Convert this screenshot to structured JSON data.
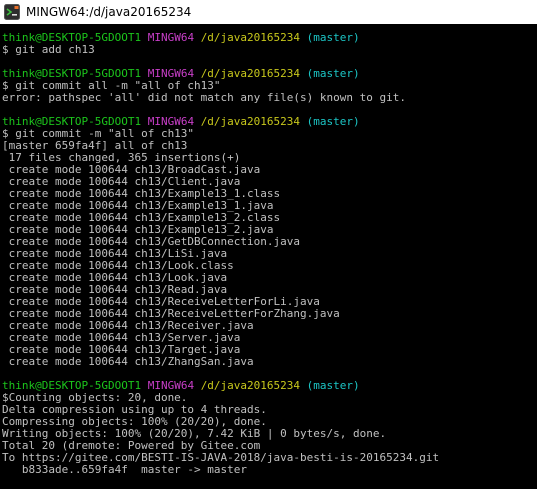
{
  "window": {
    "title": "MINGW64:/d/java20165234",
    "icon": "git-bash-icon"
  },
  "colors": {
    "background": "#000000",
    "text": "#c0c0c0",
    "prompt_user": "#1cc51c",
    "prompt_system": "#c93fc9",
    "prompt_path": "#c8c81c",
    "prompt_branch": "#1cc5c5"
  },
  "prompt": {
    "user": "think@DESKTOP-5GDOOT1",
    "system": "MINGW64",
    "path": "/d/java20165234",
    "branch": "(master)"
  },
  "blocks": [
    {
      "command": "$ git add ch13",
      "output": []
    },
    {
      "command": "$ git commit all -m \"all of ch13\"",
      "output": [
        "error: pathspec 'all' did not match any file(s) known to git."
      ]
    },
    {
      "command": "$ git commit -m \"all of ch13\"",
      "output": [
        "[master 659fa4f] all of ch13",
        " 17 files changed, 365 insertions(+)",
        " create mode 100644 ch13/BroadCast.java",
        " create mode 100644 ch13/Client.java",
        " create mode 100644 ch13/Example13_1.class",
        " create mode 100644 ch13/Example13_1.java",
        " create mode 100644 ch13/Example13_2.class",
        " create mode 100644 ch13/Example13_2.java",
        " create mode 100644 ch13/GetDBConnection.java",
        " create mode 100644 ch13/LiSi.java",
        " create mode 100644 ch13/Look.class",
        " create mode 100644 ch13/Look.java",
        " create mode 100644 ch13/Read.java",
        " create mode 100644 ch13/ReceiveLetterForLi.java",
        " create mode 100644 ch13/ReceiveLetterForZhang.java",
        " create mode 100644 ch13/Receiver.java",
        " create mode 100644 ch13/Server.java",
        " create mode 100644 ch13/Target.java",
        " create mode 100644 ch13/ZhangSan.java"
      ]
    },
    {
      "command": "$Counting objects: 20, done.",
      "output": [
        "Delta compression using up to 4 threads.",
        "Compressing objects: 100% (20/20), done.",
        "Writing objects: 100% (20/20), 7.42 KiB | 0 bytes/s, done.",
        "Total 20 (dremote: Powered by Gitee.com",
        "To https://gitee.com/BESTI-IS-JAVA-2018/java-besti-is-20165234.git",
        "   b833ade..659fa4f  master -> master"
      ]
    }
  ]
}
